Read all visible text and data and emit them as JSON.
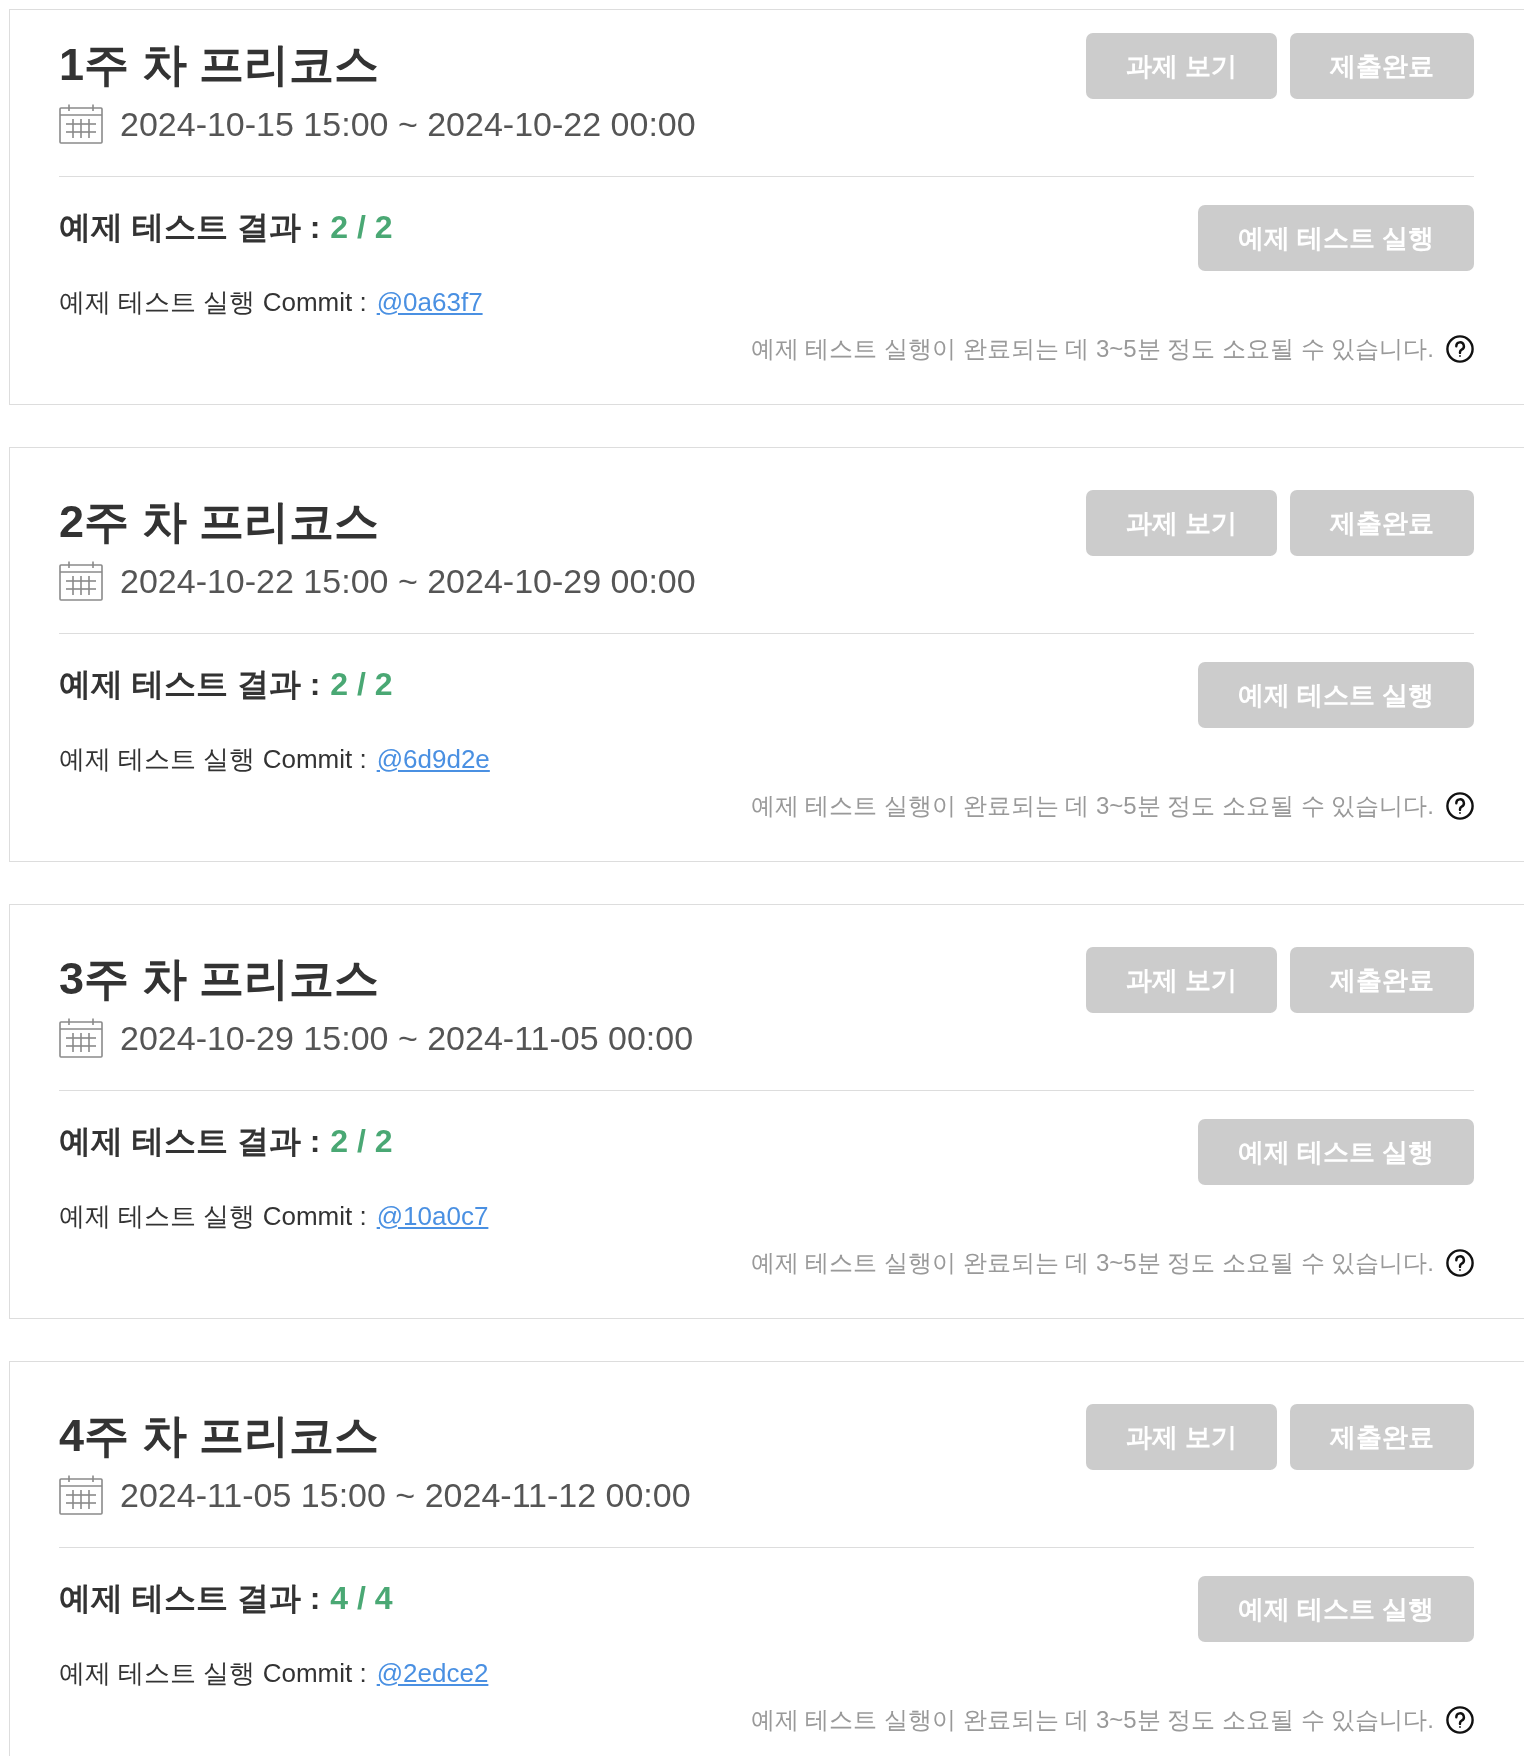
{
  "weeks": [
    {
      "title": "1주 차 프리코스",
      "date_range": "2024-10-15 15:00 ~ 2024-10-22 00:00",
      "buttons": [
        {
          "label": "과제 보기",
          "disabled": true
        },
        {
          "label": "제출완료",
          "disabled": true
        }
      ],
      "result_label": "예제 테스트 결과 :",
      "result_score": "2 / 2",
      "run_button": {
        "label": "예제 테스트 실행",
        "disabled": true
      },
      "commit_label": "예제 테스트 실행 Commit :",
      "commit_hash": "@0a63f7",
      "notice": "예제 테스트 실행이 완료되는 데 3~5분 정도 소요될 수 있습니다."
    },
    {
      "title": "2주 차 프리코스",
      "date_range": "2024-10-22 15:00 ~ 2024-10-29 00:00",
      "buttons": [
        {
          "label": "과제 보기",
          "disabled": true
        },
        {
          "label": "제출완료",
          "disabled": true
        }
      ],
      "result_label": "예제 테스트 결과 :",
      "result_score": "2 / 2",
      "run_button": {
        "label": "예제 테스트 실행",
        "disabled": true
      },
      "commit_label": "예제 테스트 실행 Commit :",
      "commit_hash": "@6d9d2e",
      "notice": "예제 테스트 실행이 완료되는 데 3~5분 정도 소요될 수 있습니다."
    },
    {
      "title": "3주 차 프리코스",
      "date_range": "2024-10-29 15:00 ~ 2024-11-05 00:00",
      "buttons": [
        {
          "label": "과제 보기",
          "disabled": true
        },
        {
          "label": "제출완료",
          "disabled": true
        }
      ],
      "result_label": "예제 테스트 결과 :",
      "result_score": "2 / 2",
      "run_button": {
        "label": "예제 테스트 실행",
        "disabled": true
      },
      "commit_label": "예제 테스트 실행 Commit :",
      "commit_hash": "@10a0c7",
      "notice": "예제 테스트 실행이 완료되는 데 3~5분 정도 소요될 수 있습니다."
    },
    {
      "title": "4주 차 프리코스",
      "date_range": "2024-11-05 15:00 ~ 2024-11-12 00:00",
      "buttons": [
        {
          "label": "과제 보기",
          "disabled": true
        },
        {
          "label": "제출완료",
          "disabled": true
        }
      ],
      "result_label": "예제 테스트 결과 :",
      "result_score": "4 / 4",
      "run_button": {
        "label": "예제 테스트 실행",
        "disabled": true
      },
      "commit_label": "예제 테스트 실행 Commit :",
      "commit_hash": "@2edce2",
      "notice": "예제 테스트 실행이 완료되는 데 3~5분 정도 소요될 수 있습니다."
    }
  ]
}
